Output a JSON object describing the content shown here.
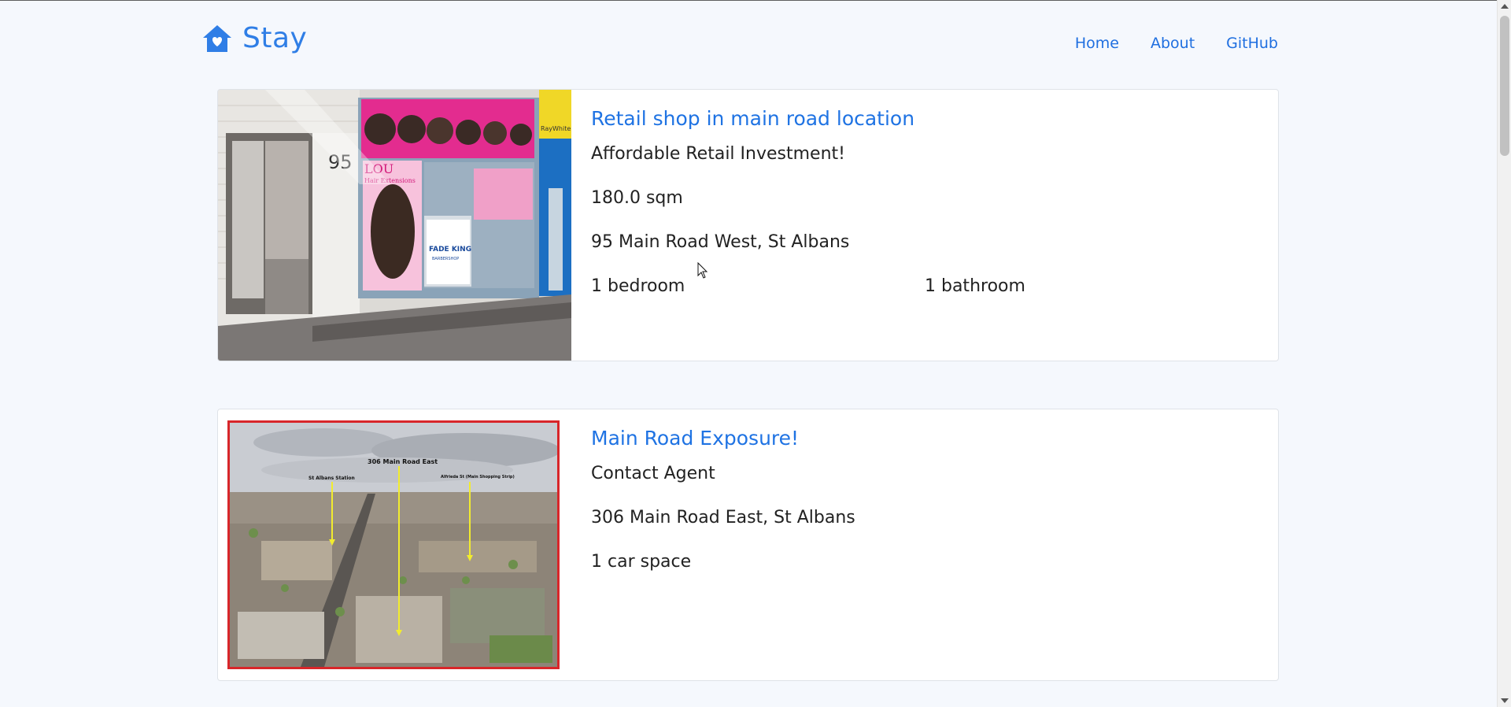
{
  "brand": {
    "name": "Stay",
    "logo_icon": "house-heart-icon",
    "color": "#2f7ee6"
  },
  "nav": {
    "links": [
      "Home",
      "About",
      "GitHub"
    ],
    "color": "#1f6fe0"
  },
  "listings": [
    {
      "title": "Retail shop in main road location",
      "price": "Affordable Retail Investment!",
      "area": "180.0 sqm",
      "address": "95 Main Road West, St Albans",
      "bedrooms": "1 bedroom",
      "bathrooms": "1 bathroom",
      "photo": {
        "street_number": "95",
        "signs": [
          "LOU",
          "Hair Extensions",
          "FADE KING",
          "BARBERSHOP",
          "RayWhite"
        ]
      }
    },
    {
      "title": "Main Road Exposure!",
      "price": "Contact Agent",
      "address": "306 Main Road East, St Albans",
      "car_spaces": "1 car space",
      "photo": {
        "labels": [
          "306 Main Road East",
          "St Albans Station",
          "Alfrieda St (Main Shopping Strip)"
        ]
      }
    }
  ],
  "colors": {
    "link": "#1f73e3",
    "background": "#f5f8fd",
    "photo_border": "#d8262a"
  }
}
